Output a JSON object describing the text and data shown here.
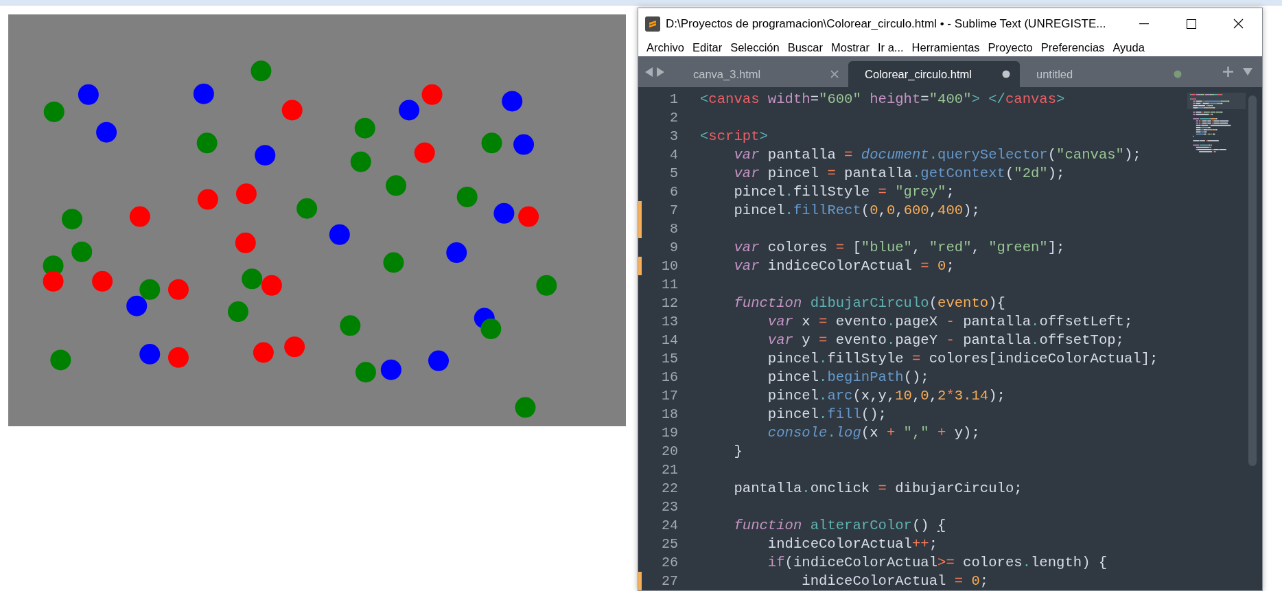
{
  "canvas": {
    "circles": [
      {
        "color": "#008000"
      },
      {
        "color": "#0000ff"
      },
      {
        "color": "#0000ff"
      },
      {
        "color": "#008000"
      },
      {
        "color": "#ff0000"
      },
      {
        "color": "#ff0000"
      },
      {
        "color": "#0000ff"
      },
      {
        "color": "#0000ff"
      },
      {
        "color": "#0000ff"
      },
      {
        "color": "#008000"
      },
      {
        "color": "#0000ff"
      },
      {
        "color": "#008000"
      },
      {
        "color": "#ff0000"
      },
      {
        "color": "#008000"
      },
      {
        "color": "#008000"
      },
      {
        "color": "#0000ff"
      },
      {
        "color": "#008000"
      },
      {
        "color": "#ff0000"
      },
      {
        "color": "#ff0000"
      },
      {
        "color": "#008000"
      },
      {
        "color": "#008000"
      },
      {
        "color": "#008000"
      },
      {
        "color": "#ff0000"
      },
      {
        "color": "#0000ff"
      },
      {
        "color": "#ff0000"
      },
      {
        "color": "#0000ff"
      },
      {
        "color": "#ff0000"
      },
      {
        "color": "#008000"
      },
      {
        "color": "#0000ff"
      },
      {
        "color": "#008000"
      },
      {
        "color": "#008000"
      },
      {
        "color": "#ff0000"
      },
      {
        "color": "#ff0000"
      },
      {
        "color": "#008000"
      },
      {
        "color": "#ff0000"
      },
      {
        "color": "#008000"
      },
      {
        "color": "#ff0000"
      },
      {
        "color": "#008000"
      },
      {
        "color": "#0000ff"
      },
      {
        "color": "#008000"
      },
      {
        "color": "#008000"
      },
      {
        "color": "#0000ff"
      },
      {
        "color": "#008000"
      },
      {
        "color": "#008000"
      },
      {
        "color": "#0000ff"
      },
      {
        "color": "#ff0000"
      },
      {
        "color": "#ff0000"
      },
      {
        "color": "#ff0000"
      },
      {
        "color": "#008000"
      },
      {
        "color": "#0000ff"
      },
      {
        "color": "#0000ff"
      },
      {
        "color": "#008000"
      }
    ]
  },
  "window": {
    "title": "D:\\Proyectos de programacion\\Colorear_circulo.html • - Sublime Text (UNREGISTE..."
  },
  "menu": [
    "Archivo",
    "Editar",
    "Selección",
    "Buscar",
    "Mostrar",
    "Ir a...",
    "Herramientas",
    "Proyecto",
    "Preferencias",
    "Ayuda"
  ],
  "tabs": [
    {
      "label": "canva_3.html",
      "selected": false,
      "modified": false
    },
    {
      "label": "Colorear_circulo.html",
      "selected": true,
      "modified": true
    },
    {
      "label": "untitled",
      "selected": false,
      "modified": true
    }
  ],
  "editor": {
    "lines": [
      {
        "number": "1",
        "modified": false,
        "tokens": [
          {
            "kind": "pun",
            "text": "<"
          },
          {
            "kind": "tag",
            "text": "canvas"
          },
          {
            "kind": "attr",
            "text": " width"
          },
          {
            "kind": "p",
            "text": "="
          },
          {
            "kind": "str",
            "text": "\"600\""
          },
          {
            "kind": "attr",
            "text": " height"
          },
          {
            "kind": "p",
            "text": "="
          },
          {
            "kind": "str",
            "text": "\"400\""
          },
          {
            "kind": "pun",
            "text": "> </"
          },
          {
            "kind": "tag",
            "text": "canvas"
          },
          {
            "kind": "pun",
            "text": ">"
          }
        ]
      },
      {
        "number": "2",
        "modified": false
      },
      {
        "number": "3",
        "modified": false,
        "tokens": [
          {
            "kind": "pun",
            "text": "<"
          },
          {
            "kind": "tag",
            "text": "script"
          },
          {
            "kind": "pun",
            "text": ">"
          }
        ]
      },
      {
        "number": "4",
        "modified": false,
        "tokens": [
          {
            "kind": "kw",
            "text": "    var"
          },
          {
            "kind": "p",
            "text": " pantalla "
          },
          {
            "kind": "op",
            "text": "="
          },
          {
            "kind": "obj",
            "text": " document"
          },
          {
            "kind": "pun",
            "text": "."
          },
          {
            "kind": "fn",
            "text": "querySelector"
          },
          {
            "kind": "p",
            "text": "("
          },
          {
            "kind": "str",
            "text": "\"canvas\""
          },
          {
            "kind": "p",
            "text": ");"
          }
        ]
      },
      {
        "number": "5",
        "modified": false,
        "tokens": [
          {
            "kind": "kw",
            "text": "    var"
          },
          {
            "kind": "p",
            "text": " pincel "
          },
          {
            "kind": "op",
            "text": "="
          },
          {
            "kind": "p",
            "text": " pantalla"
          },
          {
            "kind": "pun",
            "text": "."
          },
          {
            "kind": "fn",
            "text": "getContext"
          },
          {
            "kind": "p",
            "text": "("
          },
          {
            "kind": "str",
            "text": "\"2d\""
          },
          {
            "kind": "p",
            "text": ");"
          }
        ]
      },
      {
        "number": "6",
        "modified": false,
        "tokens": [
          {
            "kind": "p",
            "text": "    pincel"
          },
          {
            "kind": "pun",
            "text": "."
          },
          {
            "kind": "p",
            "text": "fillStyle "
          },
          {
            "kind": "op",
            "text": "="
          },
          {
            "kind": "str",
            "text": " \"grey\""
          },
          {
            "kind": "p",
            "text": ";"
          }
        ]
      },
      {
        "number": "7",
        "modified": true,
        "tokens": [
          {
            "kind": "p",
            "text": "    pincel"
          },
          {
            "kind": "pun",
            "text": "."
          },
          {
            "kind": "fn",
            "text": "fillRect"
          },
          {
            "kind": "p",
            "text": "("
          },
          {
            "kind": "num",
            "text": "0"
          },
          {
            "kind": "p",
            "text": ","
          },
          {
            "kind": "num",
            "text": "0"
          },
          {
            "kind": "p",
            "text": ","
          },
          {
            "kind": "num",
            "text": "600"
          },
          {
            "kind": "p",
            "text": ","
          },
          {
            "kind": "num",
            "text": "400"
          },
          {
            "kind": "p",
            "text": ");"
          }
        ]
      },
      {
        "number": "8",
        "modified": true
      },
      {
        "number": "9",
        "modified": false,
        "tokens": [
          {
            "kind": "kw",
            "text": "    var"
          },
          {
            "kind": "p",
            "text": " colores "
          },
          {
            "kind": "op",
            "text": "="
          },
          {
            "kind": "p",
            "text": " ["
          },
          {
            "kind": "str",
            "text": "\"blue\""
          },
          {
            "kind": "p",
            "text": ", "
          },
          {
            "kind": "str",
            "text": "\"red\""
          },
          {
            "kind": "p",
            "text": ", "
          },
          {
            "kind": "str",
            "text": "\"green\""
          },
          {
            "kind": "p",
            "text": "];"
          }
        ]
      },
      {
        "number": "10",
        "modified": true,
        "tokens": [
          {
            "kind": "kw",
            "text": "    var"
          },
          {
            "kind": "p",
            "text": " indiceColorActual "
          },
          {
            "kind": "op",
            "text": "="
          },
          {
            "kind": "num",
            "text": " 0"
          },
          {
            "kind": "p",
            "text": ";"
          }
        ]
      },
      {
        "number": "11",
        "modified": false
      },
      {
        "number": "12",
        "modified": false,
        "tokens": [
          {
            "kind": "kw",
            "text": "    function"
          },
          {
            "kind": "def",
            "text": " dibujarCirculo"
          },
          {
            "kind": "p",
            "text": "("
          },
          {
            "kind": "param",
            "text": "evento"
          },
          {
            "kind": "p",
            "text": "){"
          }
        ]
      },
      {
        "number": "13",
        "modified": false,
        "tokens": [
          {
            "kind": "kw",
            "text": "        var"
          },
          {
            "kind": "p",
            "text": " x "
          },
          {
            "kind": "op",
            "text": "="
          },
          {
            "kind": "p",
            "text": " evento"
          },
          {
            "kind": "pun",
            "text": "."
          },
          {
            "kind": "p",
            "text": "pageX "
          },
          {
            "kind": "op",
            "text": "-"
          },
          {
            "kind": "p",
            "text": " pantalla"
          },
          {
            "kind": "pun",
            "text": "."
          },
          {
            "kind": "p",
            "text": "offsetLeft;"
          }
        ]
      },
      {
        "number": "14",
        "modified": false,
        "tokens": [
          {
            "kind": "kw",
            "text": "        var"
          },
          {
            "kind": "p",
            "text": " y "
          },
          {
            "kind": "op",
            "text": "="
          },
          {
            "kind": "p",
            "text": " evento"
          },
          {
            "kind": "pun",
            "text": "."
          },
          {
            "kind": "p",
            "text": "pageY "
          },
          {
            "kind": "op",
            "text": "-"
          },
          {
            "kind": "p",
            "text": " pantalla"
          },
          {
            "kind": "pun",
            "text": "."
          },
          {
            "kind": "p",
            "text": "offsetTop;"
          }
        ]
      },
      {
        "number": "15",
        "modified": false,
        "tokens": [
          {
            "kind": "p",
            "text": "        pincel"
          },
          {
            "kind": "pun",
            "text": "."
          },
          {
            "kind": "p",
            "text": "fillStyle "
          },
          {
            "kind": "op",
            "text": "="
          },
          {
            "kind": "p",
            "text": " colores[indiceColorActual];"
          }
        ]
      },
      {
        "number": "16",
        "modified": false,
        "tokens": [
          {
            "kind": "p",
            "text": "        pincel"
          },
          {
            "kind": "pun",
            "text": "."
          },
          {
            "kind": "fn",
            "text": "beginPath"
          },
          {
            "kind": "p",
            "text": "();"
          }
        ]
      },
      {
        "number": "17",
        "modified": false,
        "tokens": [
          {
            "kind": "p",
            "text": "        pincel"
          },
          {
            "kind": "pun",
            "text": "."
          },
          {
            "kind": "fn",
            "text": "arc"
          },
          {
            "kind": "p",
            "text": "(x,y,"
          },
          {
            "kind": "num",
            "text": "10"
          },
          {
            "kind": "p",
            "text": ","
          },
          {
            "kind": "num",
            "text": "0"
          },
          {
            "kind": "p",
            "text": ","
          },
          {
            "kind": "num",
            "text": "2"
          },
          {
            "kind": "op",
            "text": "*"
          },
          {
            "kind": "num",
            "text": "3.14"
          },
          {
            "kind": "p",
            "text": ");"
          }
        ]
      },
      {
        "number": "18",
        "modified": false,
        "tokens": [
          {
            "kind": "p",
            "text": "        pincel"
          },
          {
            "kind": "pun",
            "text": "."
          },
          {
            "kind": "fn",
            "text": "fill"
          },
          {
            "kind": "p",
            "text": "();"
          }
        ]
      },
      {
        "number": "19",
        "modified": false,
        "tokens": [
          {
            "kind": "obj",
            "text": "        console"
          },
          {
            "kind": "pun",
            "text": "."
          },
          {
            "kind": "obj",
            "text": "log"
          },
          {
            "kind": "p",
            "text": "(x "
          },
          {
            "kind": "op",
            "text": "+"
          },
          {
            "kind": "str",
            "text": " \",\""
          },
          {
            "kind": "op",
            "text": " +"
          },
          {
            "kind": "p",
            "text": " y);"
          }
        ]
      },
      {
        "number": "20",
        "modified": false,
        "tokens": [
          {
            "kind": "p",
            "text": "    }"
          }
        ]
      },
      {
        "number": "21",
        "modified": false
      },
      {
        "number": "22",
        "modified": false,
        "tokens": [
          {
            "kind": "p",
            "text": "    pantalla"
          },
          {
            "kind": "pun",
            "text": "."
          },
          {
            "kind": "p",
            "text": "onclick "
          },
          {
            "kind": "op",
            "text": "="
          },
          {
            "kind": "p",
            "text": " dibujarCirculo;"
          }
        ]
      },
      {
        "number": "23",
        "modified": false
      },
      {
        "number": "24",
        "modified": false,
        "tokens": [
          {
            "kind": "kw",
            "text": "    function"
          },
          {
            "kind": "def",
            "text": " alterarColor"
          },
          {
            "kind": "p",
            "text": "() "
          },
          {
            "kind": "brm",
            "text": "{"
          }
        ]
      },
      {
        "number": "25",
        "modified": false,
        "tokens": [
          {
            "kind": "p",
            "text": "        indiceColorActual"
          },
          {
            "kind": "op",
            "text": "++"
          },
          {
            "kind": "p",
            "text": ";"
          }
        ]
      },
      {
        "number": "26",
        "modified": false,
        "tokens": [
          {
            "kind": "ctl",
            "text": "        if"
          },
          {
            "kind": "p",
            "text": "(indiceColorActual"
          },
          {
            "kind": "op",
            "text": ">="
          },
          {
            "kind": "p",
            "text": " colores"
          },
          {
            "kind": "pun",
            "text": "."
          },
          {
            "kind": "p",
            "text": "length) {"
          }
        ]
      },
      {
        "number": "27",
        "modified": true,
        "tokens": [
          {
            "kind": "p",
            "text": "            indiceColorActual "
          },
          {
            "kind": "op",
            "text": "="
          },
          {
            "kind": "num",
            "text": " 0"
          },
          {
            "kind": "p",
            "text": ";"
          }
        ]
      }
    ]
  }
}
